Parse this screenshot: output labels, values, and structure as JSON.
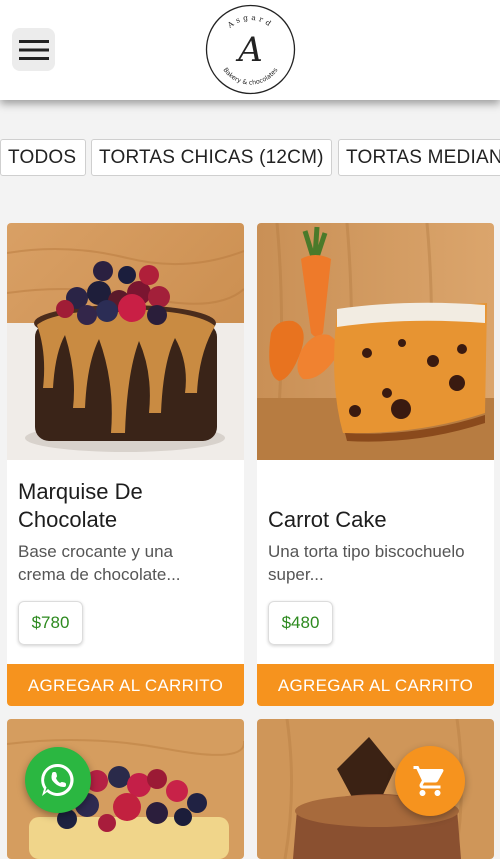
{
  "header": {
    "menu_icon": "hamburger-menu-icon",
    "logo": {
      "letter": "A",
      "brand": "Asgard",
      "tagline": "Bakery & chocolates"
    }
  },
  "categories": [
    {
      "label": "TODOS"
    },
    {
      "label": "TORTAS CHICAS (12CM)"
    },
    {
      "label": "TORTAS MEDIANAS"
    }
  ],
  "products": [
    {
      "name": "Marquise De Chocolate",
      "description": "Base crocante y una crema de chocolate...",
      "price": "$780",
      "button": "AGREGAR AL CARRITO"
    },
    {
      "name": "Carrot Cake",
      "description": "Una torta tipo biscochuelo super...",
      "price": "$480",
      "button": "AGREGAR AL CARRITO"
    }
  ],
  "floating": {
    "whatsapp_icon": "whatsapp-icon",
    "cart_icon": "shopping-cart-icon"
  },
  "colors": {
    "accent": "#f6931e",
    "price_text": "#2d8a1f",
    "whatsapp": "#2bb741",
    "background": "#f3f3f3"
  }
}
